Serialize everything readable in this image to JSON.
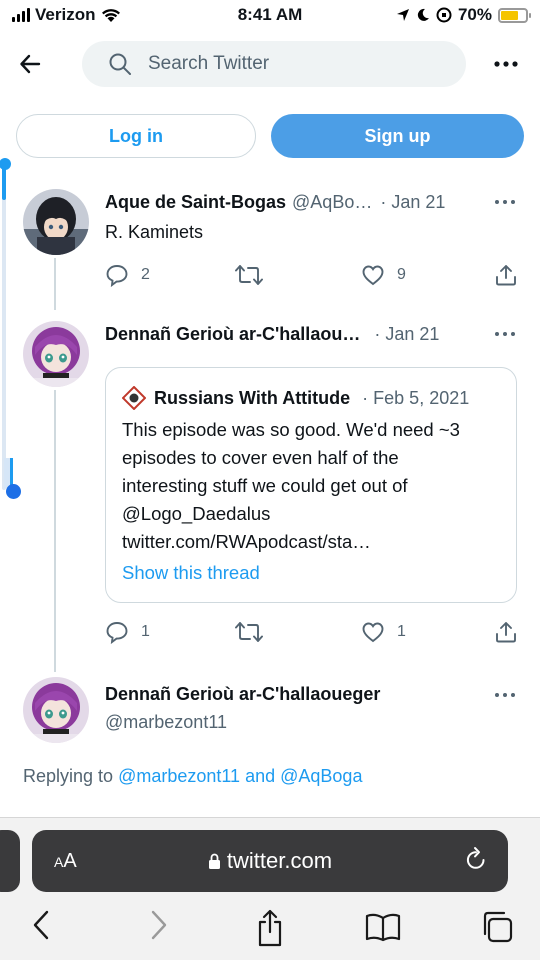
{
  "status_bar": {
    "carrier": "Verizon",
    "time": "8:41 AM",
    "battery_percent_label": "70%",
    "battery_level": 0.7
  },
  "header": {
    "search_placeholder": "Search Twitter"
  },
  "auth": {
    "login_label": "Log in",
    "signup_label": "Sign up"
  },
  "tweets": [
    {
      "name": "Aque de Saint-Bogas",
      "handle": "@AqBo…",
      "date": "· Jan 21",
      "text": "R. Kaminets",
      "replies": "2",
      "retweets": "",
      "likes": "9"
    },
    {
      "name": "Dennañ Gerioù ar-C'hallaou…",
      "handle": "",
      "date": "· Jan 21",
      "replies": "1",
      "retweets": "",
      "likes": "1",
      "quote": {
        "name": "Russians With Attitude",
        "date": "· Feb 5, 2021",
        "lines": [
          "This episode was so good. We'd need ~3",
          "episodes to cover even half of the",
          "interesting stuff we could get out of",
          "@Logo_Daedalus",
          "twitter.com/RWApodcast/sta…"
        ],
        "show_thread": "Show this thread"
      }
    },
    {
      "name": "Dennañ Gerioù ar-C'hallaoueger",
      "handle": "@marbezont11"
    }
  ],
  "replying": {
    "prefix": "Replying to ",
    "user1": "@marbezont11",
    "and": " and ",
    "user2": "@AqBoga"
  },
  "safari": {
    "aa_label": "AA",
    "url": "twitter.com"
  },
  "colors": {
    "accent": "#1d9bf0",
    "signup_bg": "#4c9ee6",
    "safari_bar": "#3a3a3c"
  }
}
